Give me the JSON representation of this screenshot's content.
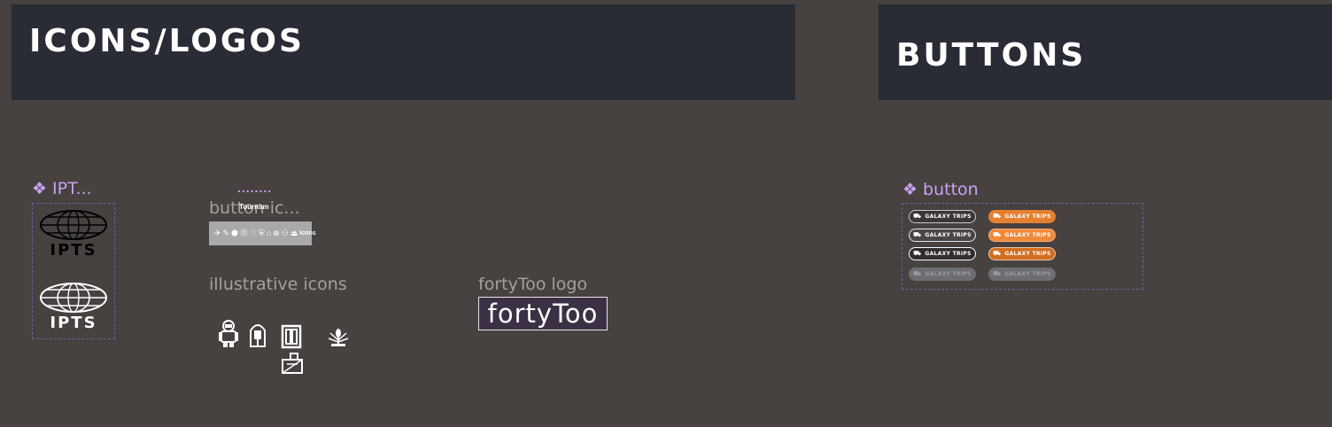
{
  "sections": {
    "icons_logos_title": "ICONS/LOGOS",
    "buttons_title": "BUTTONS"
  },
  "components": {
    "ipts": {
      "label": "IPT...",
      "logos": [
        {
          "text": "IPTS",
          "variant": "outline"
        },
        {
          "text": "IPTS",
          "variant": "light"
        }
      ]
    },
    "button_icons": {
      "label": "button ic...",
      "dots": "........",
      "overlay_text": "Tournam",
      "strip_glyphs": [
        "✈",
        "✎",
        "⬢",
        "⓪",
        "♡",
        "⛨",
        "⌂",
        "⊕",
        "⚇",
        "⏏"
      ],
      "strip_label": "Icons"
    },
    "illustrative": {
      "label": "illustrative icons",
      "icons": [
        "astronaut-icon",
        "robot-icon",
        "door-icon",
        "plant-icon",
        "crate-icon"
      ]
    },
    "fortytoo": {
      "label": "fortyToo logo",
      "logo_text": "fortyToo"
    },
    "button": {
      "label": "button",
      "button_text": "GALAXY TRIPS",
      "rows": [
        {
          "state": "default"
        },
        {
          "state": "hover"
        },
        {
          "state": "active"
        },
        {
          "state": "disabled"
        }
      ]
    }
  },
  "colors": {
    "canvas": "#474140",
    "header": "#292b35",
    "component_label": "#c7a2f2",
    "accent_orange": "#e58031"
  }
}
